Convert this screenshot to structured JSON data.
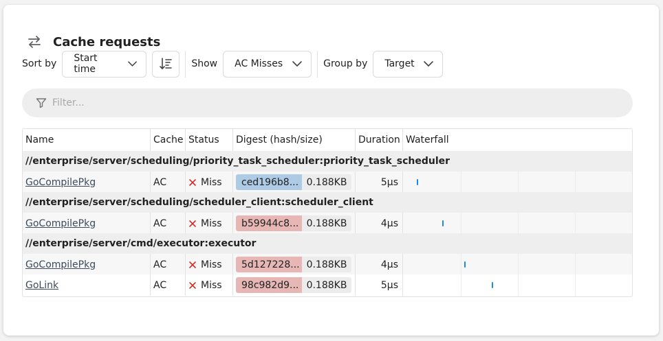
{
  "header": {
    "title": "Cache requests",
    "icon": "swap-arrows-icon"
  },
  "controls": {
    "sort_label": "Sort by",
    "sort_value": "Start time",
    "show_label": "Show",
    "show_value": "AC Misses",
    "group_label": "Group by",
    "group_value": "Target"
  },
  "filter": {
    "placeholder": "Filter...",
    "value": ""
  },
  "table": {
    "columns": [
      "Name",
      "Cache",
      "Status",
      "Digest (hash/size)",
      "Duration",
      "Waterfall"
    ],
    "groups": [
      {
        "target": "//enterprise/server/scheduling/priority_task_scheduler:priority_task_scheduler",
        "rows": [
          {
            "name": "GoCompilePkg",
            "cache": "AC",
            "status": "Miss",
            "hash": "ced196b8...",
            "size": "0.188KB",
            "duration": "5µs",
            "wf_pos": 0.06,
            "hash_color": "#aecbe6"
          }
        ]
      },
      {
        "target": "//enterprise/server/scheduling/scheduler_client:scheduler_client",
        "rows": [
          {
            "name": "GoCompilePkg",
            "cache": "AC",
            "status": "Miss",
            "hash": "b59944c8...",
            "size": "0.188KB",
            "duration": "4µs",
            "wf_pos": 0.17,
            "hash_color": "#e6b7b5"
          }
        ]
      },
      {
        "target": "//enterprise/server/cmd/executor:executor",
        "rows": [
          {
            "name": "GoCompilePkg",
            "cache": "AC",
            "status": "Miss",
            "hash": "5d127228...",
            "size": "0.188KB",
            "duration": "4µs",
            "wf_pos": 0.265,
            "hash_color": "#e6b7b5"
          },
          {
            "name": "GoLink",
            "cache": "AC",
            "status": "Miss",
            "hash": "98c982d9...",
            "size": "0.188KB",
            "duration": "5µs",
            "wf_pos": 0.385,
            "hash_color": "#e6b7b5"
          }
        ]
      }
    ]
  },
  "colors": {
    "miss": "#d32f2f",
    "waterfall_tick": "#1e88e5"
  }
}
